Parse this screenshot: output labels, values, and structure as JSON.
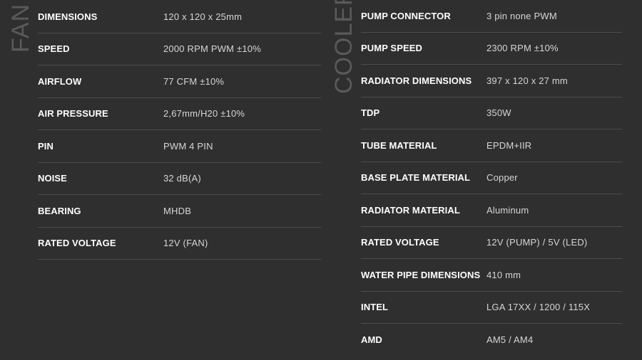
{
  "fan": {
    "label": "FAN",
    "rows": [
      {
        "key": "DIMENSIONS",
        "value": "120 x 120 x 25mm"
      },
      {
        "key": "SPEED",
        "value": "2000 RPM PWM ±10%"
      },
      {
        "key": "AIRFLOW",
        "value": "77 CFM ±10%"
      },
      {
        "key": "AIR PRESSURE",
        "value": "2,67mm/H20 ±10%"
      },
      {
        "key": "PIN",
        "value": "PWM 4 PIN"
      },
      {
        "key": "NOISE",
        "value": "32 dB(A)"
      },
      {
        "key": "BEARING",
        "value": "MHDB"
      },
      {
        "key": "RATED VOLTAGE",
        "value": "12V (FAN)"
      }
    ]
  },
  "cooler": {
    "label": "COOLER",
    "rows": [
      {
        "key": "PUMP CONNECTOR",
        "value": "3 pin none PWM"
      },
      {
        "key": "PUMP SPEED",
        "value": "2300 RPM ±10%"
      },
      {
        "key": "RADIATOR DIMENSIONS",
        "value": "397 x 120 x 27 mm"
      },
      {
        "key": "TDP",
        "value": "350W"
      },
      {
        "key": "TUBE MATERIAL",
        "value": "EPDM+IIR"
      },
      {
        "key": "BASE PLATE MATERIAL",
        "value": "Copper"
      },
      {
        "key": "RADIATOR MATERIAL",
        "value": "Aluminum"
      },
      {
        "key": "RATED VOLTAGE",
        "value": "12V (PUMP) / 5V (LED)"
      },
      {
        "key": "WATER PIPE DIMENSIONS",
        "value": "410 mm"
      },
      {
        "key": "INTEL",
        "value": "LGA 17XX / 1200 / 115X"
      },
      {
        "key": "AMD",
        "value": "AM5 / AM4"
      }
    ]
  }
}
